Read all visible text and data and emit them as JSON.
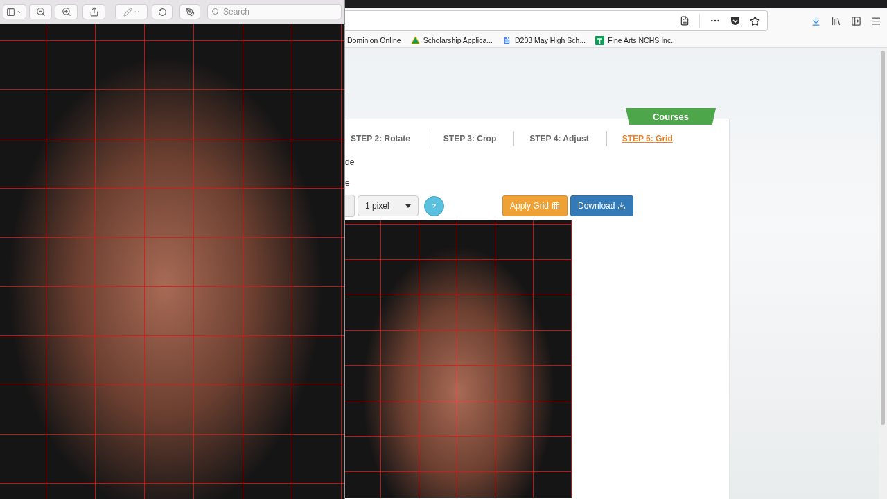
{
  "viewer": {
    "search": {
      "placeholder": "Search"
    }
  },
  "browser": {
    "bookmarks": [
      {
        "label": "Dominion Online",
        "kind": "plain"
      },
      {
        "label": "Scholarship Applica...",
        "kind": "drive"
      },
      {
        "label": "D203 May High Sch...",
        "kind": "doc"
      },
      {
        "label": "Fine Arts NCHS Inc...",
        "kind": "sheet"
      }
    ]
  },
  "page": {
    "ribbon": "Courses",
    "steps": [
      {
        "label": "STEP 2: Rotate",
        "selected": false
      },
      {
        "label": "STEP 3: Crop",
        "selected": false
      },
      {
        "label": "STEP 4: Adjust",
        "selected": false
      },
      {
        "label": "STEP 5: Grid",
        "selected": true
      }
    ],
    "labels": [
      "de",
      "e"
    ],
    "select": {
      "value": "1 pixel"
    },
    "help_button": "?",
    "buttons": [
      {
        "label": "Apply Grid",
        "kind": "apply"
      },
      {
        "label": "Download",
        "kind": "download"
      }
    ]
  }
}
